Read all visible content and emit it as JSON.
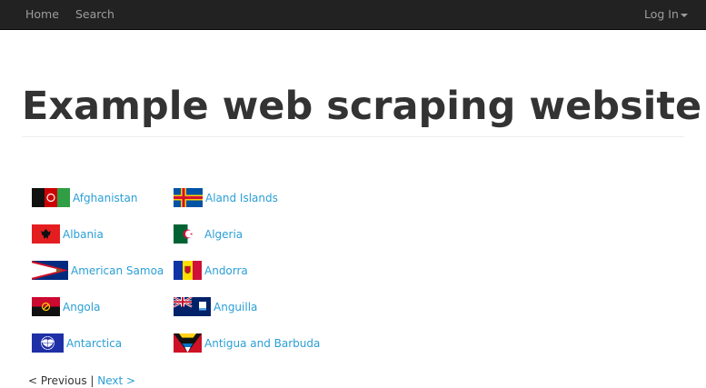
{
  "navbar": {
    "home_label": "Home",
    "search_label": "Search",
    "login_label": "Log In"
  },
  "page_title": "Example web scraping website",
  "countries": [
    {
      "name": "Afghanistan",
      "flag": "afghanistan-flag-icon"
    },
    {
      "name": "Aland Islands",
      "flag": "aland-islands-flag-icon"
    },
    {
      "name": "Albania",
      "flag": "albania-flag-icon"
    },
    {
      "name": "Algeria",
      "flag": "algeria-flag-icon"
    },
    {
      "name": "American Samoa",
      "flag": "american-samoa-flag-icon"
    },
    {
      "name": "Andorra",
      "flag": "andorra-flag-icon"
    },
    {
      "name": "Angola",
      "flag": "angola-flag-icon"
    },
    {
      "name": "Anguilla",
      "flag": "anguilla-flag-icon"
    },
    {
      "name": "Antarctica",
      "flag": "antarctica-flag-icon"
    },
    {
      "name": "Antigua and Barbuda",
      "flag": "antigua-and-barbuda-flag-icon"
    }
  ],
  "pager": {
    "previous_label": "< Previous",
    "separator": " | ",
    "next_label": "Next >"
  },
  "colors": {
    "navbar_bg": "#222222",
    "nav_text": "#9d9d9d",
    "link": "#2a9fd6",
    "title_text": "#333333"
  }
}
